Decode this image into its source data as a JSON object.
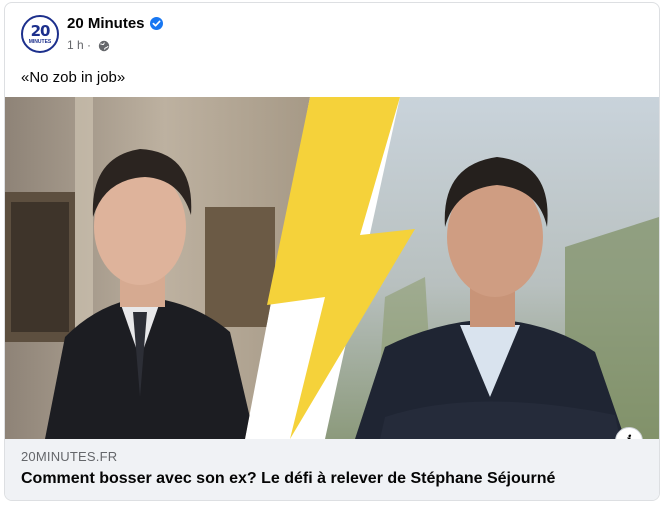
{
  "post": {
    "page_name": "20 Minutes",
    "avatar_text": "20",
    "avatar_subtext": "MINUTES",
    "time": "1 h ·",
    "text": "«No zob in job»"
  },
  "link": {
    "domain": "20MINUTES.FR",
    "headline": "Comment bosser avec son ex? Le défi à relever de Stéphane Séjourné",
    "info_label": "i"
  },
  "colors": {
    "brand": "#1c2f8c",
    "verified": "#1877f2",
    "lightning": "#f5d23a",
    "preview_bg": "#f0f2f5"
  },
  "icons": [
    "verified-badge-icon",
    "globe-icon",
    "info-icon",
    "lightning-bolt-icon"
  ]
}
